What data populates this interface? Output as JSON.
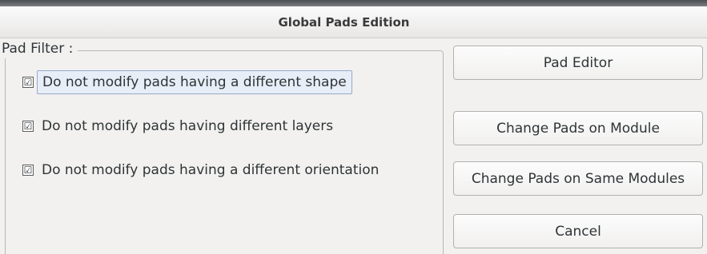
{
  "window": {
    "title": "Global Pads Edition"
  },
  "pad_filter": {
    "label": "Pad Filter :",
    "options": [
      {
        "label": "Do not modify pads having a different shape",
        "checked": true
      },
      {
        "label": "Do not modify pads having different layers",
        "checked": true
      },
      {
        "label": "Do not modify pads having a different orientation",
        "checked": true
      }
    ]
  },
  "buttons": {
    "pad_editor": "Pad Editor",
    "change_module": "Change Pads on Module",
    "change_same_modules": "Change Pads on Same Modules",
    "cancel": "Cancel"
  },
  "check_glyph": "☑"
}
